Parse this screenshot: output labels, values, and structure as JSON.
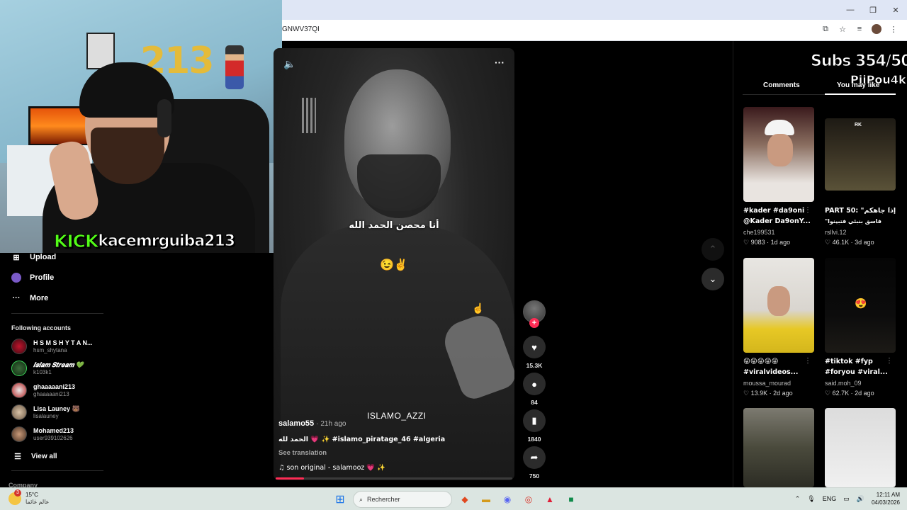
{
  "browser": {
    "url_fragment": "GNWV37QI"
  },
  "stream_overlay": {
    "kick_logo": "KICK",
    "kick_username": "kacemrguiba213",
    "subs_counter": "Subs 354/500",
    "overlay_name": "PiiPou4k",
    "balloon_text": "213"
  },
  "sidebar": {
    "nav": [
      {
        "label": "Upload",
        "icon": "plus-square-icon"
      },
      {
        "label": "Profile",
        "icon": "profile-icon"
      },
      {
        "label": "More",
        "icon": "ellipsis-icon"
      }
    ],
    "following_title": "Following accounts",
    "accounts": [
      {
        "name": "H S M  S H Y T A N...",
        "handle": "hsm_shytana"
      },
      {
        "name": "𝑰𝒔𝒍𝒂𝒎 𝑺𝒕𝒓𝒆𝒂𝒎 💚",
        "handle": "k103k1"
      },
      {
        "name": "ghaaaaani213",
        "handle": "ghaaaaani213"
      },
      {
        "name": "Lisa Launey 🐻",
        "handle": "lisalauney"
      },
      {
        "name": "Mohamed213",
        "handle": "user939102626"
      }
    ],
    "view_all": "View all",
    "company": "Company"
  },
  "video": {
    "caption_arabic": "أنا محصن الحمد الله",
    "caption_emoji": "😉✌️",
    "watermark": "ISLAMO_AZZI",
    "author": "salamo55",
    "time_ago": "· 21h ago",
    "description": "الحمد لله 💗 ✨ #islamo_piratage_46 #algeria",
    "see_translation": "See translation",
    "music": "♫  son original - salamooz 💗 ✨",
    "progress_fraction": 0.12,
    "counts": {
      "likes": "15.3K",
      "comments": "84",
      "saves": "1840",
      "shares": "750"
    }
  },
  "right_panel": {
    "tabs": [
      "Comments",
      "You may like"
    ],
    "active_tab": "You may like",
    "cards": [
      {
        "title1": "#kader #da9oni",
        "title2": "@Kader Da9onY...",
        "user": "che199531",
        "likes": "♡ 9083",
        "ago": "· 1d ago"
      },
      {
        "title1": "PART 50: \"إذا جاهكم",
        "title2": "\"فاسق بنبئي فتبينوا",
        "user": "rsllvi.12",
        "likes": "♡ 46.1K",
        "ago": "· 3d ago"
      },
      {
        "title1": "😝😝😝😝😝",
        "title2": "#viralvideos...",
        "user": "moussa_mourad",
        "likes": "♡ 13.9K",
        "ago": "· 2d ago"
      },
      {
        "title1": "#tiktok #fyp",
        "title2": "#foryou #viral...",
        "user": "said.moh_09",
        "likes": "♡ 62.7K",
        "ago": "· 2d ago"
      }
    ],
    "thumb_labels": {
      "card2_badge": "RK",
      "card4_emoji": "😍"
    }
  },
  "taskbar": {
    "weather_temp": "15°C",
    "weather_desc": "عالم غائما",
    "weather_badge": "3",
    "search_placeholder": "Rechercher",
    "lang": "ENG",
    "time": "12:11 AM",
    "date": "04/03/2026"
  },
  "colors": {
    "accent_pink": "#fe2c55",
    "kick_green": "#53fc18"
  }
}
